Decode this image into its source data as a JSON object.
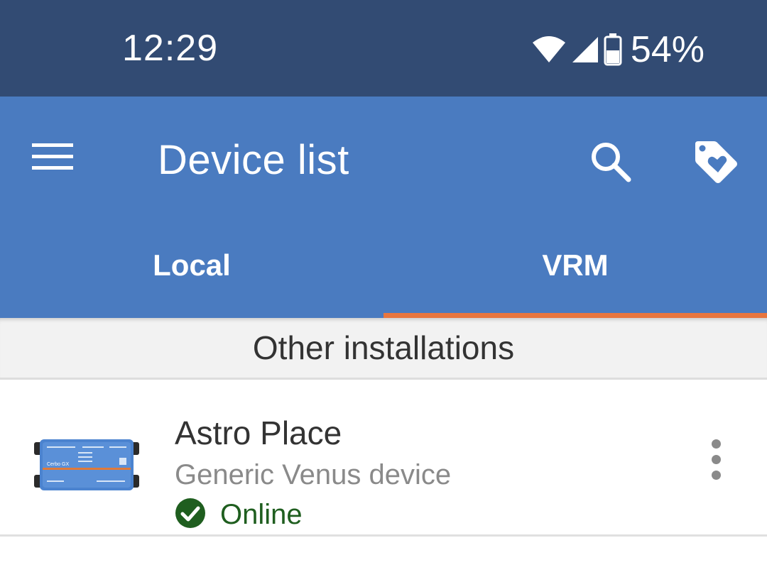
{
  "status_bar": {
    "time": "12:29",
    "battery_percent": "54%",
    "icons": [
      "wifi-icon",
      "cell-signal-icon",
      "battery-icon"
    ]
  },
  "app_bar": {
    "title": "Device list",
    "icons": [
      "menu-icon",
      "search-icon",
      "tag-heart-icon"
    ]
  },
  "tabs": [
    {
      "label": "Local",
      "active": false
    },
    {
      "label": "VRM",
      "active": true
    }
  ],
  "section": {
    "title": "Other installations"
  },
  "devices": [
    {
      "name": "Astro Place",
      "type": "Generic Venus device",
      "status": "Online",
      "image_label": "Cerbo GX"
    }
  ],
  "colors": {
    "status_bar": "#324b73",
    "app_bar": "#4a7bc0",
    "tab_indicator": "#e8763f",
    "online": "#1f5e1f"
  }
}
